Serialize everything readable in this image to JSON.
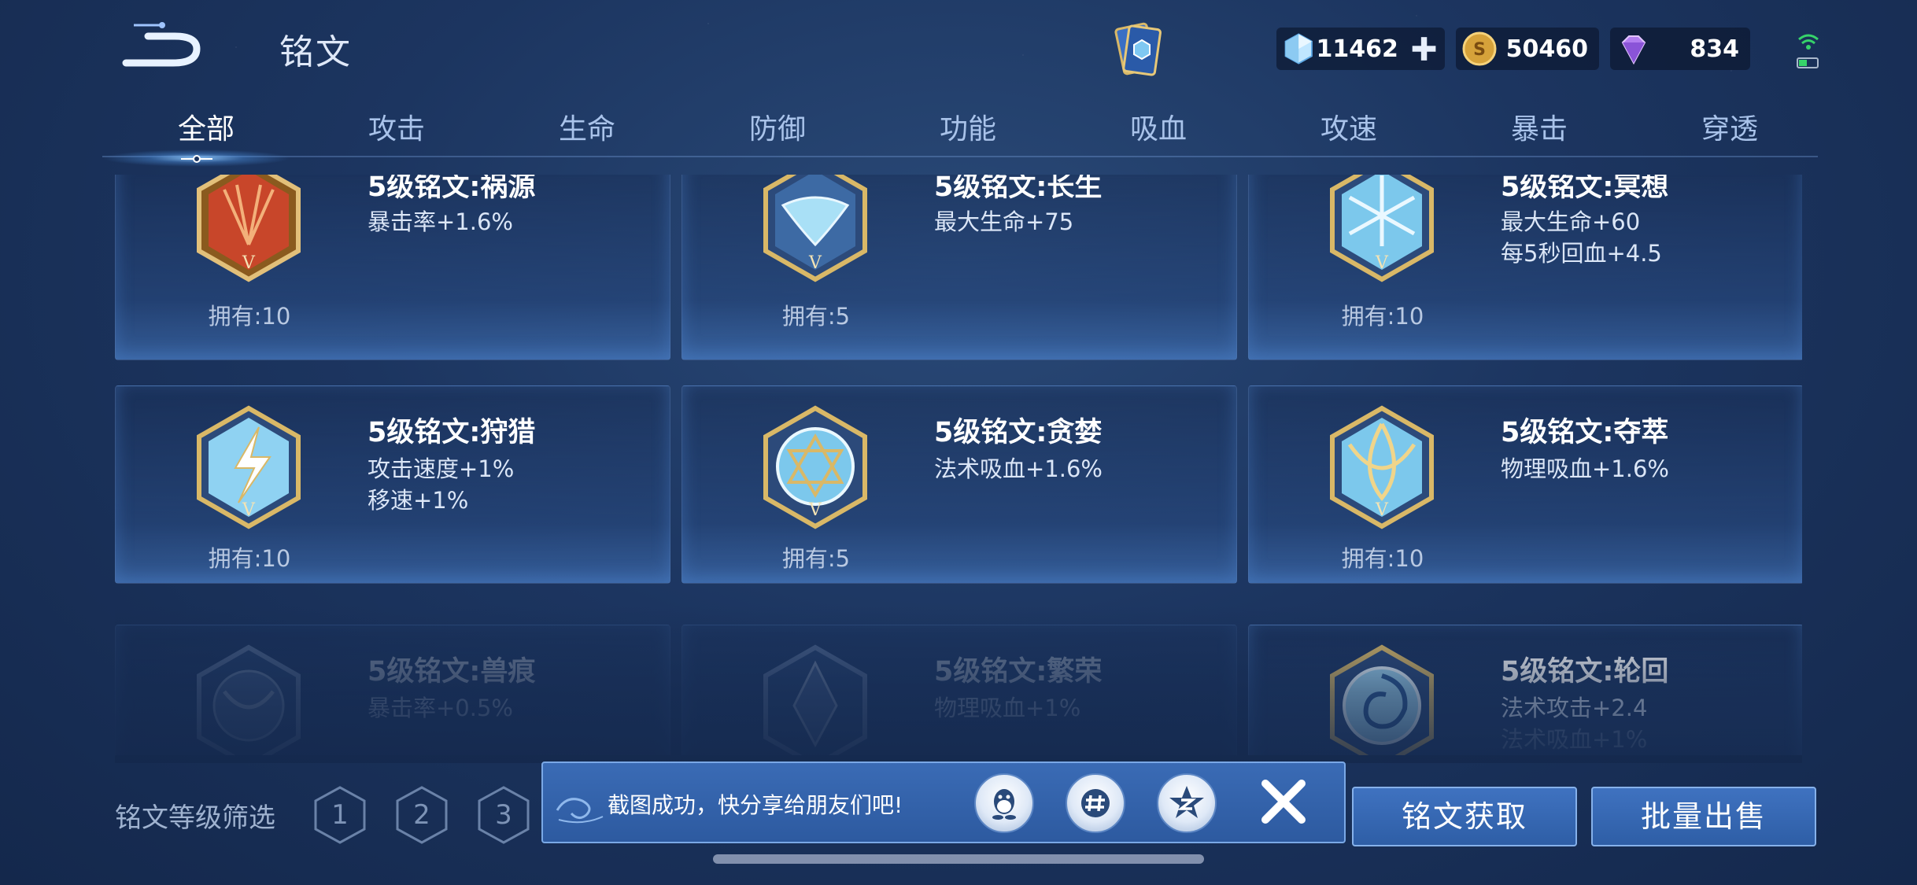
{
  "header": {
    "title": "铭文",
    "currencies": [
      {
        "name": "gem",
        "value": "11462"
      },
      {
        "name": "gold",
        "value": "50460"
      },
      {
        "name": "diamond",
        "value": "834"
      }
    ]
  },
  "tabs": [
    {
      "label": "全部",
      "active": true
    },
    {
      "label": "攻击",
      "active": false
    },
    {
      "label": "生命",
      "active": false
    },
    {
      "label": "防御",
      "active": false
    },
    {
      "label": "功能",
      "active": false
    },
    {
      "label": "吸血",
      "active": false
    },
    {
      "label": "攻速",
      "active": false
    },
    {
      "label": "暴击",
      "active": false
    },
    {
      "label": "穿透",
      "active": false
    }
  ],
  "runes": [
    {
      "name": "5级铭文:祸源",
      "attrs": [
        "暴击率+1.6%"
      ],
      "owned": "拥有:10",
      "color": "#c8462a"
    },
    {
      "name": "5级铭文:长生",
      "attrs": [
        "最大生命+75"
      ],
      "owned": "拥有:5",
      "color": "#7ec6e6"
    },
    {
      "name": "5级铭文:冥想",
      "attrs": [
        "最大生命+60",
        "每5秒回血+4.5"
      ],
      "owned": "拥有:10",
      "color": "#7ec6e6"
    },
    {
      "name": "5级铭文:狩猎",
      "attrs": [
        "攻击速度+1%",
        "移速+1%"
      ],
      "owned": "拥有:10",
      "color": "#7ec6e6"
    },
    {
      "name": "5级铭文:贪婪",
      "attrs": [
        "法术吸血+1.6%"
      ],
      "owned": "拥有:5",
      "color": "#7ec6e6"
    },
    {
      "name": "5级铭文:夺萃",
      "attrs": [
        "物理吸血+1.6%"
      ],
      "owned": "拥有:10",
      "color": "#7ec6e6"
    },
    {
      "name": "5级铭文:兽痕",
      "attrs": [
        "暴击率+0.5%"
      ],
      "owned": "",
      "color": "#7ec6e6"
    },
    {
      "name": "5级铭文:繁荣",
      "attrs": [
        "物理吸血+1%"
      ],
      "owned": "",
      "color": "#7ec6e6"
    },
    {
      "name": "5级铭文:轮回",
      "attrs": [
        "法术攻击+2.4",
        "法术吸血+1%"
      ],
      "owned": "",
      "color": "#7ec6e6"
    }
  ],
  "filter": {
    "label": "铭文等级筛选",
    "levels": [
      "1",
      "2",
      "3"
    ]
  },
  "toast": {
    "message": "截图成功，快分享给朋友们吧!",
    "share_targets": [
      "qq-icon",
      "wechat-moments-icon",
      "qzone-icon"
    ]
  },
  "buttons": {
    "obtain": "铭文获取",
    "bulk_sell": "批量出售"
  },
  "colors": {
    "accent": "#3f72c0",
    "gold_frame": "#c9a24e",
    "background": "#1c3560"
  }
}
